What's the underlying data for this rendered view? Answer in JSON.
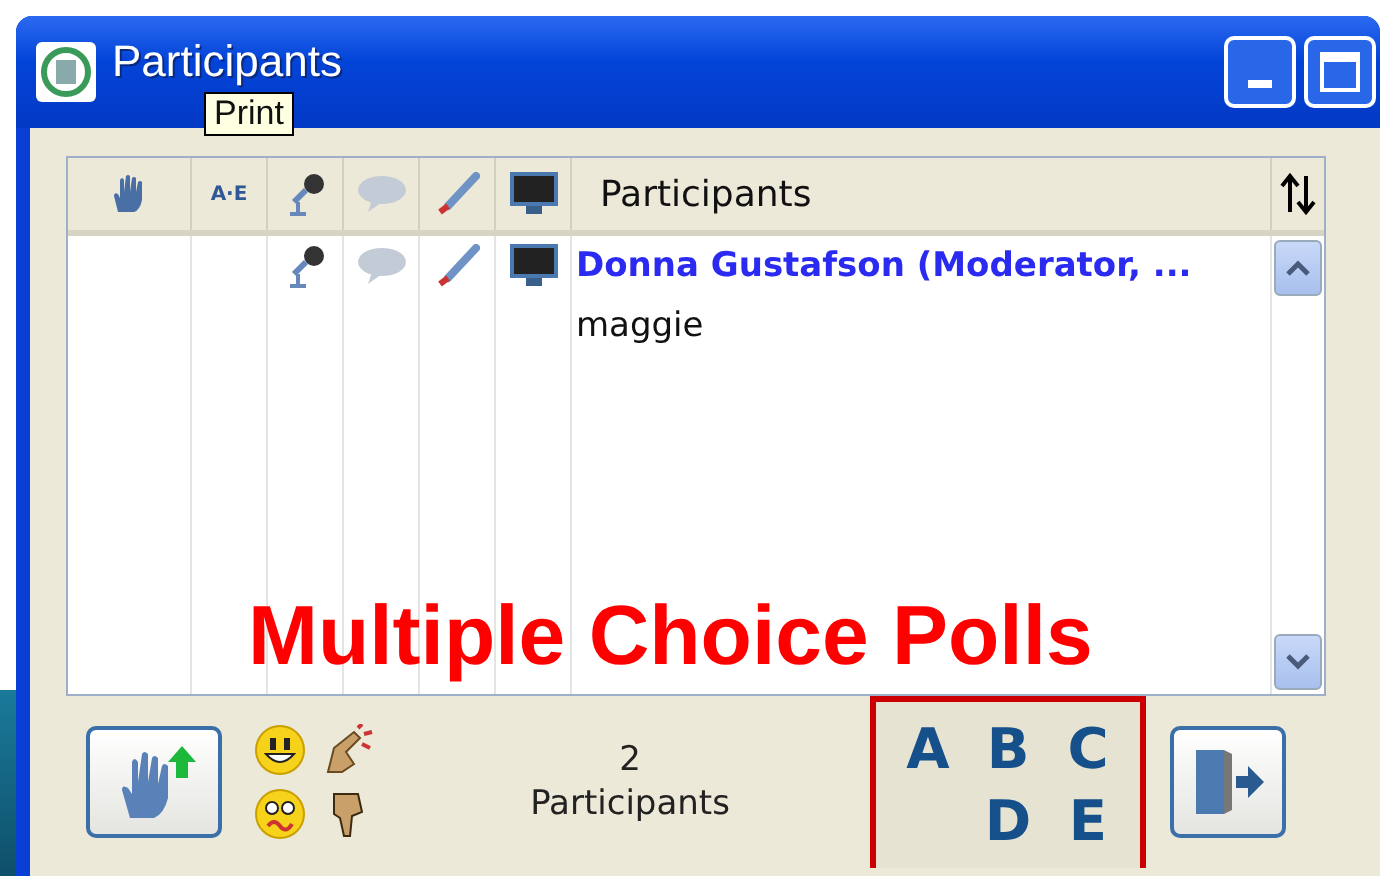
{
  "window": {
    "title": "Participants"
  },
  "tooltip": {
    "text": "Print"
  },
  "columns": [
    {
      "kind": "hand"
    },
    {
      "kind": "text",
      "label": "A·E"
    },
    {
      "kind": "mic"
    },
    {
      "kind": "chat"
    },
    {
      "kind": "pen"
    },
    {
      "kind": "monitor"
    },
    {
      "kind": "name",
      "label": "Participants"
    }
  ],
  "rows": [
    {
      "name": "Donna Gustafson (Moderator, ...",
      "kind": "moderator"
    },
    {
      "name": "maggie",
      "kind": "participant"
    }
  ],
  "footer": {
    "count": "2",
    "count_label": "Participants",
    "poll_letters": [
      "A",
      "B",
      "C",
      "D",
      "E"
    ]
  },
  "callout": {
    "text": "Multiple Choice Polls"
  }
}
